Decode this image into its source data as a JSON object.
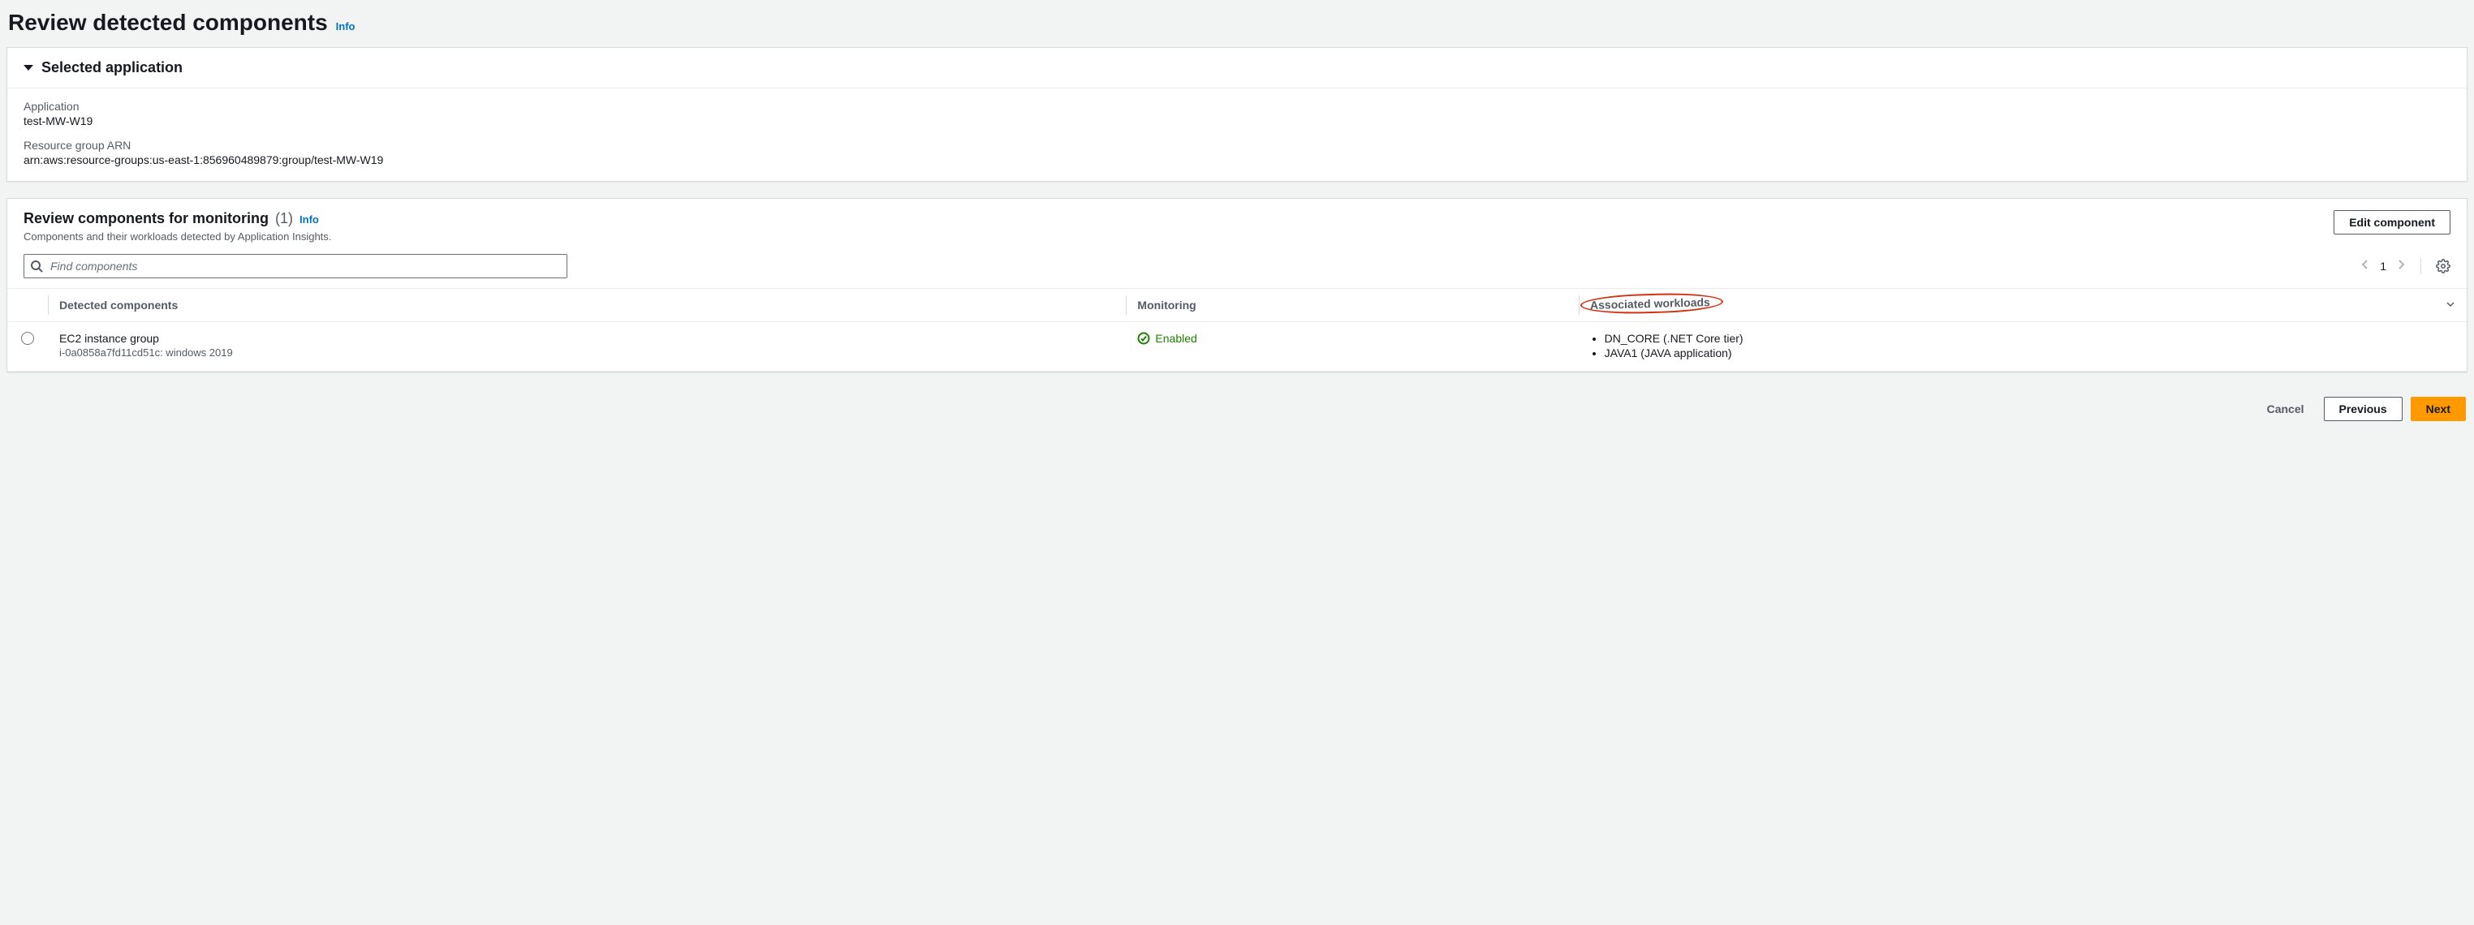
{
  "page": {
    "title": "Review detected components",
    "info_label": "Info"
  },
  "selected_application": {
    "header": "Selected application",
    "application_label": "Application",
    "application_value": "test-MW-W19",
    "arn_label": "Resource group ARN",
    "arn_value": "arn:aws:resource-groups:us-east-1:856960489879:group/test-MW-W19"
  },
  "components_section": {
    "title": "Review components for monitoring",
    "count_display": "(1)",
    "info_label": "Info",
    "description": "Components and their workloads detected by Application Insights.",
    "edit_button": "Edit component",
    "search_placeholder": "Find components",
    "page_number": "1",
    "columns": {
      "detected": "Detected components",
      "monitoring": "Monitoring",
      "workloads": "Associated workloads"
    },
    "rows": [
      {
        "name": "EC2 instance group",
        "subtitle": "i-0a0858a7fd11cd51c: windows 2019",
        "monitoring": "Enabled",
        "workloads": [
          "DN_CORE (.NET Core tier)",
          "JAVA1 (JAVA application)"
        ]
      }
    ]
  },
  "footer": {
    "cancel": "Cancel",
    "previous": "Previous",
    "next": "Next"
  }
}
